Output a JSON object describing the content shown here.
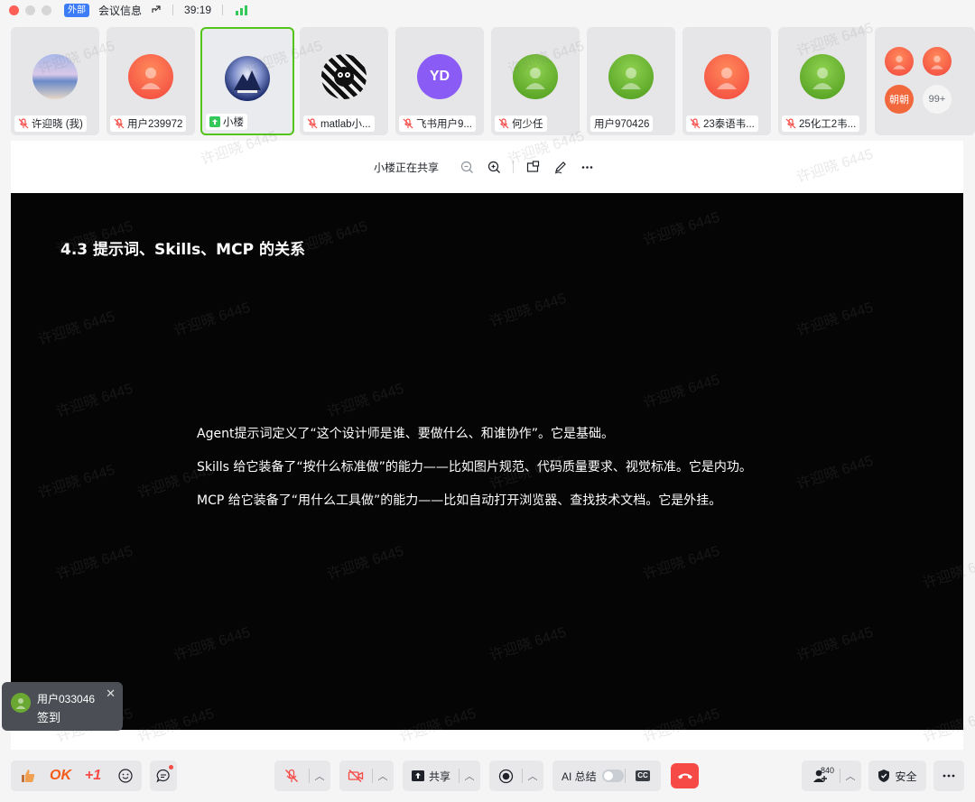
{
  "titlebar": {
    "external_badge": "外部",
    "meeting_info": "会议信息",
    "elapsed_time": "39:19",
    "signal_icon": "signal-bars-icon"
  },
  "participants": [
    {
      "name": "许迎晓 (我)",
      "mic": "muted",
      "avatar": "photo-sky"
    },
    {
      "name": "用户239972",
      "mic": "muted",
      "avatar": "person-orange"
    },
    {
      "name": "小楼",
      "mic": "sharing",
      "avatar": "photo-mountain",
      "active": true
    },
    {
      "name": "matlab小...",
      "mic": "muted",
      "avatar": "photo-cartoon"
    },
    {
      "name": "飞书用户9...",
      "mic": "muted",
      "avatar_text": "YD"
    },
    {
      "name": "何少任",
      "mic": "muted",
      "avatar": "person-green"
    },
    {
      "name": "用户970426",
      "mic": "none",
      "avatar": "person-green"
    },
    {
      "name": "23泰语韦...",
      "mic": "muted",
      "avatar": "person-orange"
    },
    {
      "name": "25化工2韦...",
      "mic": "muted",
      "avatar": "person-green"
    }
  ],
  "more_participants": {
    "mini_avatar_text": "朝朝",
    "count": "99+"
  },
  "share_bar": {
    "label": "小楼正在共享",
    "tools": [
      "zoom-out-icon",
      "zoom-in-icon",
      "pip-icon",
      "annotate-icon",
      "more-icon"
    ]
  },
  "slide": {
    "title": "4.3 提示词、Skills、MCP 的关系",
    "lines": [
      "Agent提示词定义了“这个设计师是谁、要做什么、和谁协作”。它是基础。",
      "Skills 给它装备了“按什么标准做”的能力——比如图片规范、代码质量要求、视觉标准。它是内功。",
      "MCP 给它装备了“用什么工具做”的能力——比如自动打开浏览器、查找技术文档。它是外挂。"
    ]
  },
  "watermark": "许迎晓 6445",
  "checkin_popup": {
    "user": "用户033046",
    "action": "签到"
  },
  "toolbar": {
    "reaction_ok": "OK",
    "reaction_plus1": "+1",
    "share_label": "共享",
    "ai_summary_label": "AI 总结",
    "ai_summary_enabled": false,
    "cc_label": "CC",
    "participants_count": "840",
    "security_label": "安全"
  },
  "colors": {
    "accent_green": "#52c41a",
    "end_call_red": "#f54a45",
    "external_badge_blue": "#3c7cf7",
    "muted_red": "#f54a45"
  }
}
